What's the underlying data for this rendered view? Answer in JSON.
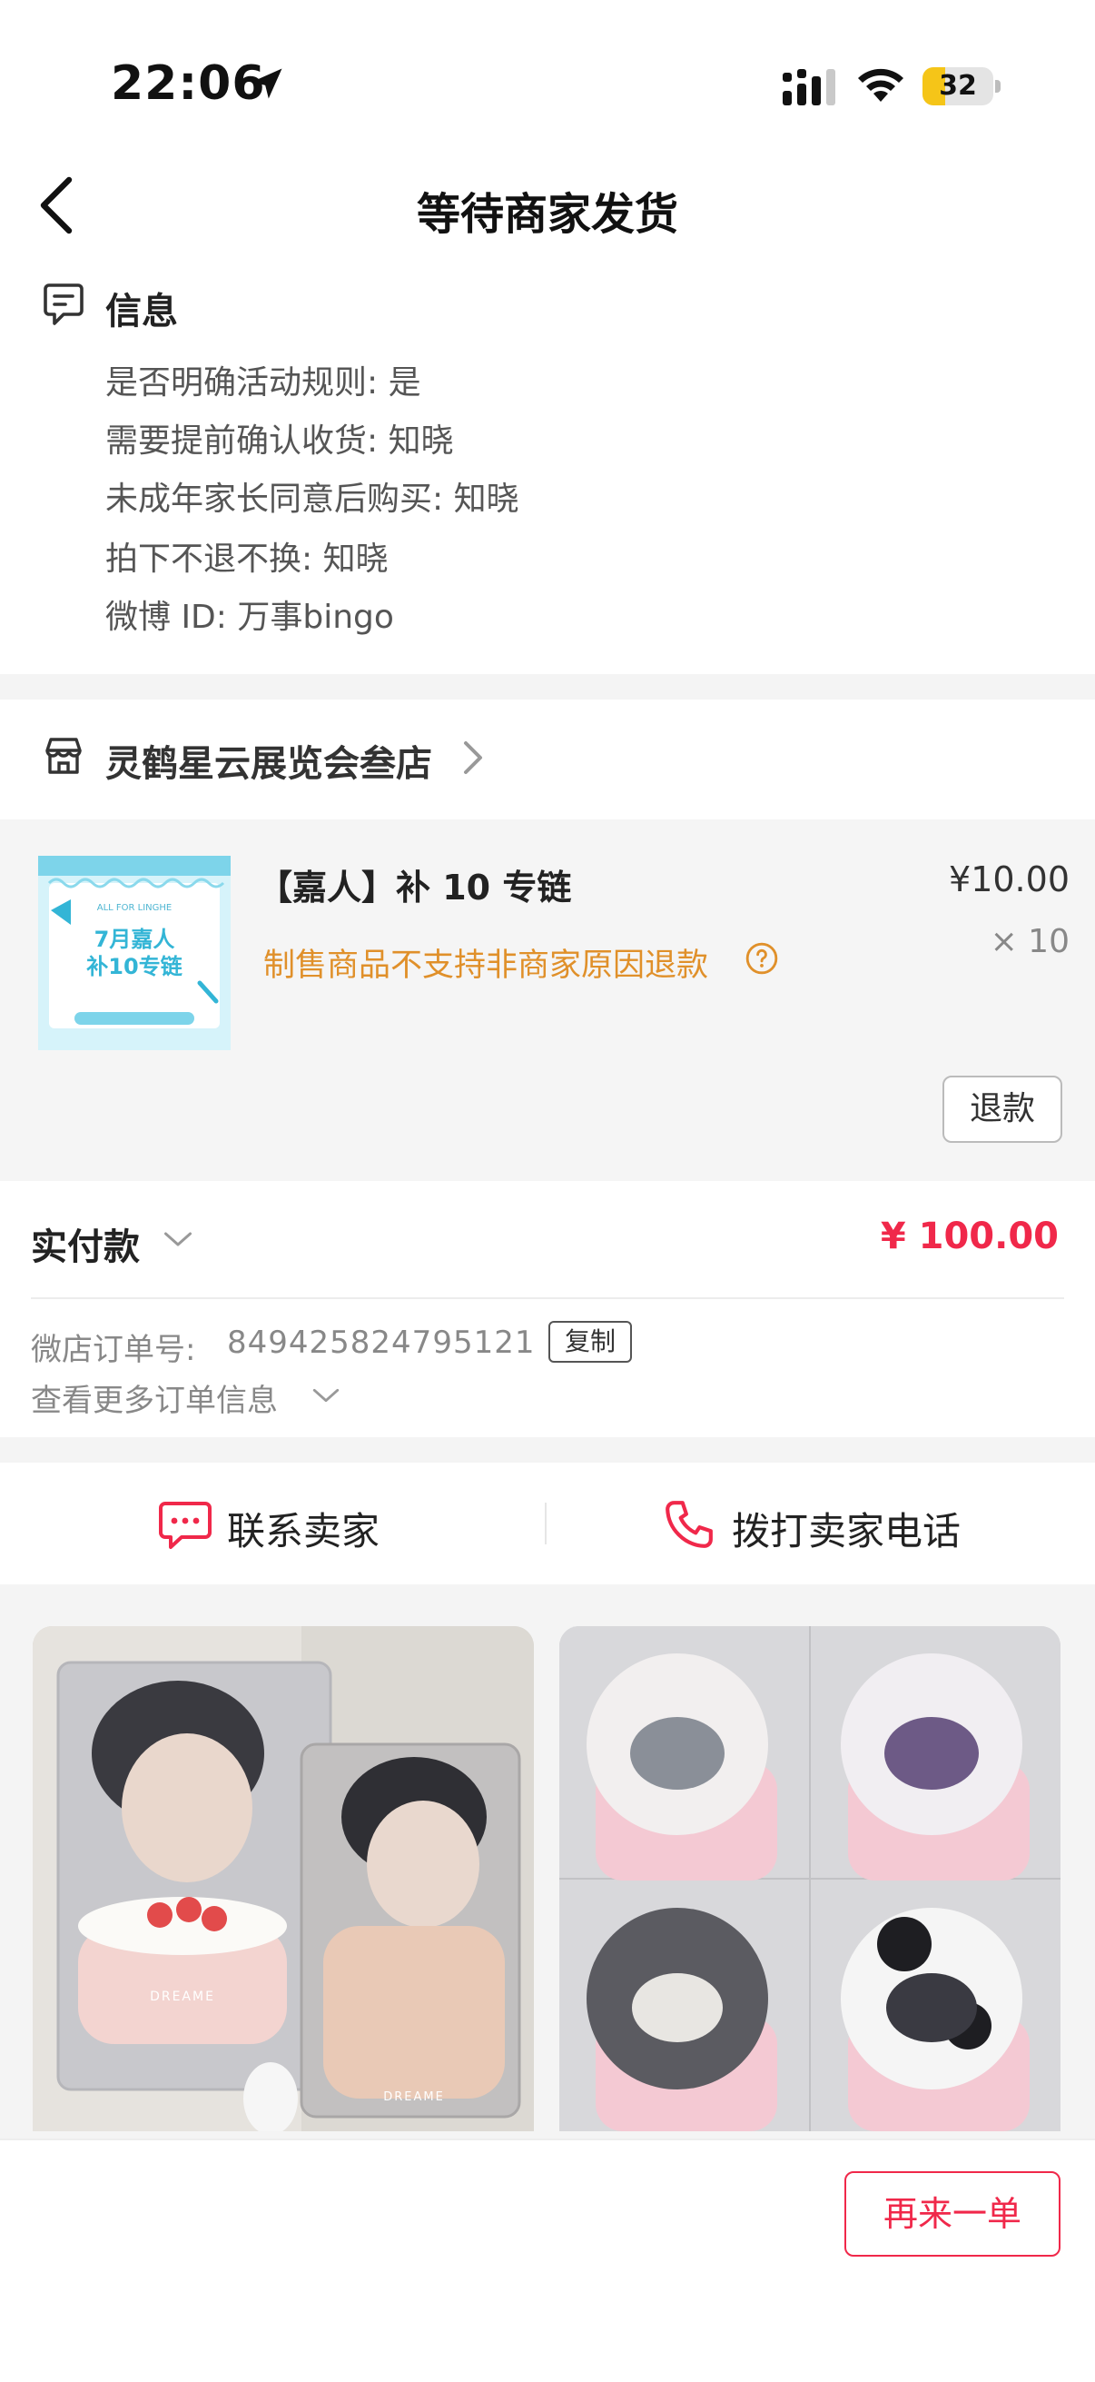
{
  "status_bar": {
    "time": "22:06",
    "battery": "32",
    "battery_level": 0.32
  },
  "header": {
    "title": "等待商家发货"
  },
  "info": {
    "heading": "信息",
    "lines": [
      "是否明确活动规则: 是",
      "需要提前确认收货: 知晓",
      "未成年家长同意后购买: 知晓",
      "拍下不退不换: 知晓",
      "微博 ID: 万事bingo"
    ]
  },
  "store": {
    "name": "灵鹤星云展览会叁店"
  },
  "product": {
    "name": "【嘉人】补 10 专链",
    "price": "¥10.00",
    "quantity": "× 10",
    "notice": "制售商品不支持非商家原因退款",
    "thumb_text": {
      "top": "ALL FOR LINGHE",
      "main_line1": "7月嘉人",
      "main_line2": "补10专链"
    },
    "refund_label": "退款"
  },
  "payment": {
    "paid_label": "实付款",
    "paid_amount": "¥ 100.00",
    "order_no_label": "微店订单号:",
    "order_no": "849425824795121",
    "copy_label": "复制",
    "more_info": "查看更多订单信息"
  },
  "contact": {
    "contact_label": "联系卖家",
    "call_label": "拨打卖家电话"
  },
  "recommendations": {
    "card1_brand": "DREAME",
    "card2_brand": "DREAME"
  },
  "bottom": {
    "reorder_label": "再来一单"
  },
  "colors": {
    "accent_red": "#f0284a",
    "notice_orange": "#e0902a",
    "battery_yellow": "#f5c518"
  },
  "icons": [
    "location-arrow-icon",
    "signal-icon",
    "wifi-icon",
    "battery-icon",
    "back-arrow-icon",
    "info-icon",
    "store-icon",
    "chevron-right-icon",
    "help-icon",
    "chevron-down-icon",
    "chat-icon",
    "phone-icon"
  ]
}
